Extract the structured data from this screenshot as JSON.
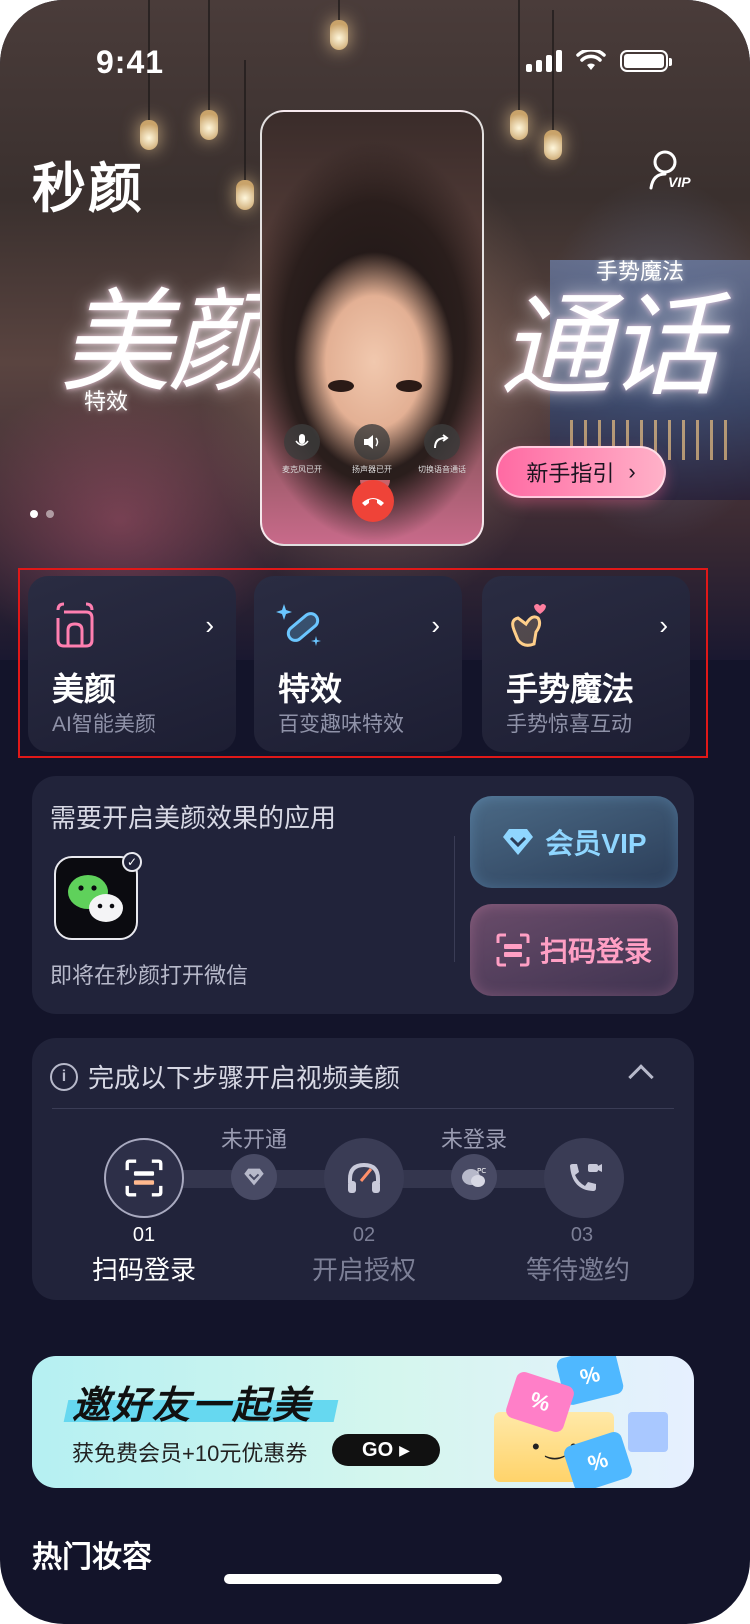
{
  "status_bar": {
    "time": "9:41"
  },
  "app": {
    "title": "秒颜",
    "vip_badge": "VIP"
  },
  "hero": {
    "left_word": "美颜",
    "left_tag": "特效",
    "right_word": "通话",
    "right_tag": "手势魔法",
    "call_controls": [
      {
        "label": "麦克风已开",
        "icon": "mic-icon"
      },
      {
        "label": "扬声器已开",
        "icon": "speaker-icon"
      },
      {
        "label": "切换语音通话",
        "icon": "voice-switch-icon"
      }
    ],
    "guide_button": "新手指引",
    "carousel": {
      "count": 2,
      "active": 0
    }
  },
  "features": [
    {
      "title": "美颜",
      "subtitle": "AI智能美颜",
      "icon": "face-beauty-icon"
    },
    {
      "title": "特效",
      "subtitle": "百变趣味特效",
      "icon": "magic-wand-icon"
    },
    {
      "title": "手势魔法",
      "subtitle": "手势惊喜互动",
      "icon": "finger-heart-icon"
    }
  ],
  "app_panel": {
    "heading": "需要开启美颜效果的应用",
    "app_icon": "wechat-icon",
    "note": "即将在秒颜打开微信",
    "vip_button": "会员VIP",
    "scan_button": "扫码登录"
  },
  "steps": {
    "heading": "完成以下步骤开启视频美颜",
    "connectors": [
      "未开通",
      "未登录"
    ],
    "items": [
      {
        "num": "01",
        "label": "扫码登录",
        "icon": "scan-icon",
        "active": true
      },
      {
        "num": "02",
        "label": "开启授权",
        "icon": "headset-icon",
        "active": false
      },
      {
        "num": "03",
        "label": "等待邀约",
        "icon": "video-call-icon",
        "active": false
      }
    ]
  },
  "banner": {
    "title": "邀好友一起美",
    "subtitle": "获免费会员+10元优惠券",
    "go_label": "GO",
    "coupon_symbol": "%"
  },
  "section": {
    "title": "热门妆容"
  },
  "colors": {
    "accent_pink": "#ff6aa3",
    "vip_blue": "#8fd6ff",
    "scan_pink": "#ff9fc4",
    "bg": "#13142a"
  }
}
